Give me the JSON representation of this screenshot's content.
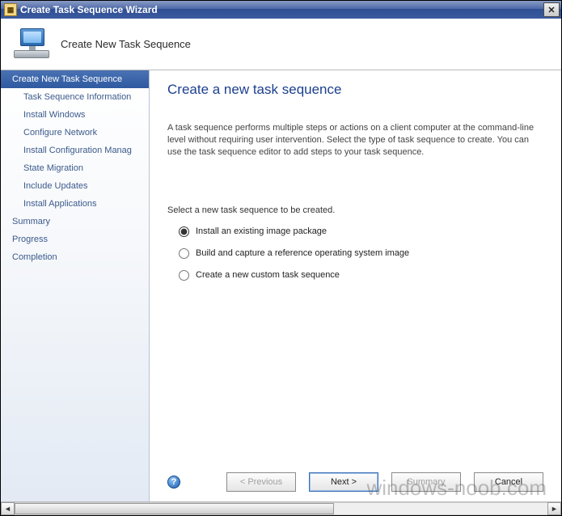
{
  "window": {
    "title": "Create Task Sequence Wizard",
    "close_glyph": "✕"
  },
  "header": {
    "title": "Create New Task Sequence"
  },
  "sidebar": {
    "items": [
      {
        "label": "Create New Task Sequence",
        "indent": false,
        "active": true
      },
      {
        "label": "Task Sequence Information",
        "indent": true,
        "active": false
      },
      {
        "label": "Install Windows",
        "indent": true,
        "active": false
      },
      {
        "label": "Configure Network",
        "indent": true,
        "active": false
      },
      {
        "label": "Install Configuration Manag",
        "indent": true,
        "active": false
      },
      {
        "label": "State Migration",
        "indent": true,
        "active": false
      },
      {
        "label": "Include Updates",
        "indent": true,
        "active": false
      },
      {
        "label": "Install Applications",
        "indent": true,
        "active": false
      },
      {
        "label": "Summary",
        "indent": false,
        "active": false
      },
      {
        "label": "Progress",
        "indent": false,
        "active": false
      },
      {
        "label": "Completion",
        "indent": false,
        "active": false
      }
    ]
  },
  "content": {
    "heading": "Create a new task sequence",
    "description": "A task sequence performs multiple steps or actions on a client computer at the command-line level without requiring user intervention. Select the type of task sequence to create. You can use the task sequence editor to add steps to your task sequence.",
    "prompt": "Select a new task sequence to be created.",
    "options": [
      {
        "label": "Install an existing image package",
        "selected": true
      },
      {
        "label": "Build and capture a reference operating system image",
        "selected": false
      },
      {
        "label": "Create a new custom task sequence",
        "selected": false
      }
    ]
  },
  "footer": {
    "help_glyph": "?",
    "previous": "< Previous",
    "next": "Next >",
    "summary": "Summary",
    "cancel": "Cancel",
    "previous_enabled": false,
    "next_enabled": true,
    "summary_enabled": false,
    "cancel_enabled": true
  },
  "watermark": "windows-noob.com",
  "scrollbar": {
    "left_glyph": "◄",
    "right_glyph": "►"
  }
}
